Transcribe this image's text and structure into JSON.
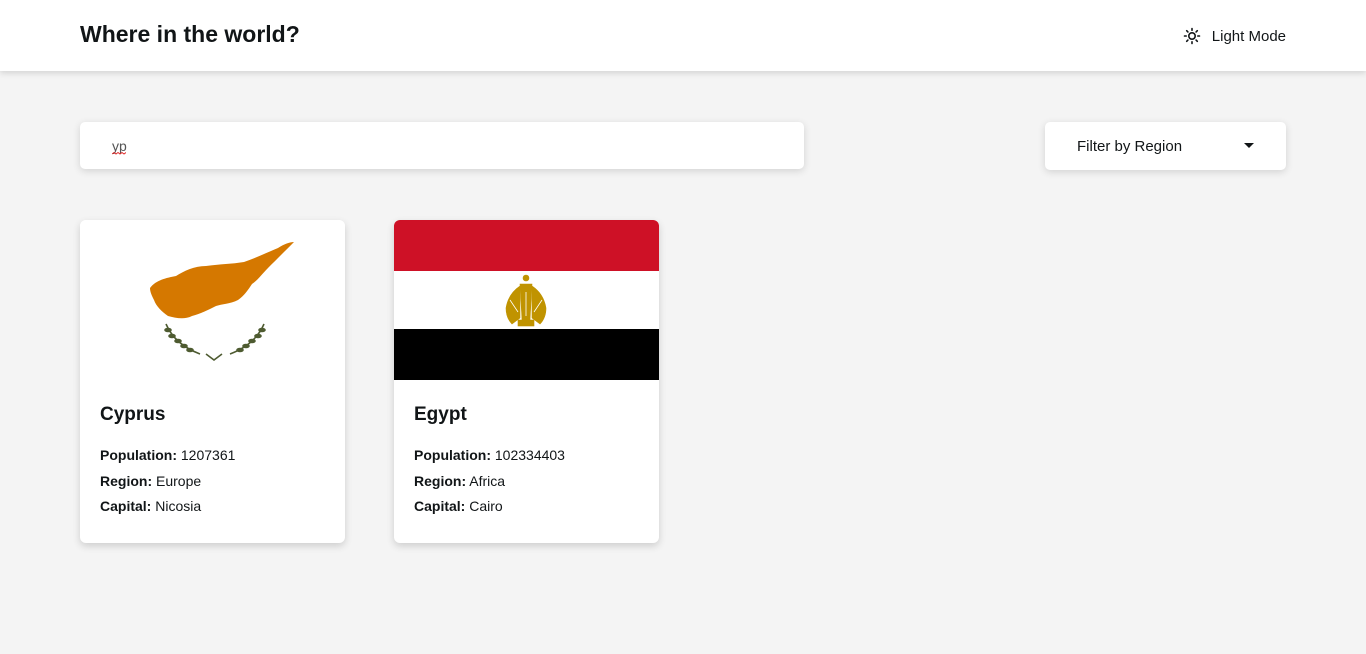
{
  "header": {
    "title": "Where in the world?",
    "mode_label": "Light Mode",
    "mode_icon": "sun-icon"
  },
  "search": {
    "value": "yp",
    "icon": "search-icon"
  },
  "filter": {
    "label": "Filter by Region",
    "icon": "caret-down-icon"
  },
  "countries": [
    {
      "name": "Cyprus",
      "population_label": "Population:",
      "population": "1207361",
      "region_label": "Region:",
      "region": "Europe",
      "capital_label": "Capital:",
      "capital": "Nicosia",
      "flag": "cyprus-flag"
    },
    {
      "name": "Egypt",
      "population_label": "Population:",
      "population": "102334403",
      "region_label": "Region:",
      "region": "Africa",
      "capital_label": "Capital:",
      "capital": "Cairo",
      "flag": "egypt-flag"
    }
  ],
  "colors": {
    "background": "#f4f4f4",
    "surface": "#ffffff",
    "text": "#111517",
    "cyprus_orange": "#d57800",
    "cyprus_green": "#4e5b31",
    "egypt_red": "#ce1126",
    "egypt_black": "#000000",
    "egypt_gold": "#c09300"
  }
}
